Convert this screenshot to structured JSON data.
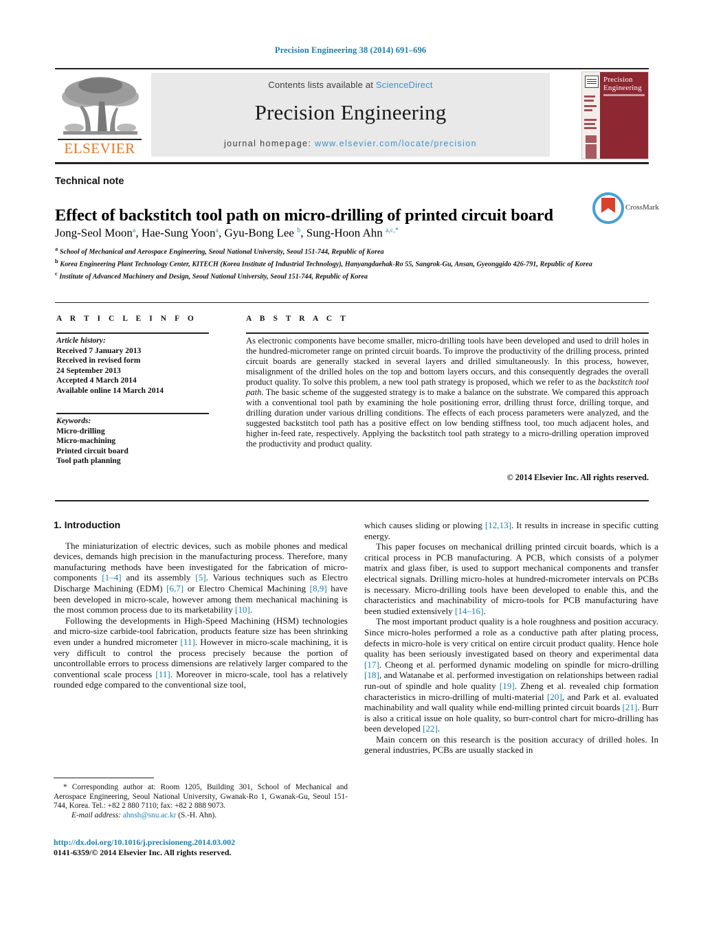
{
  "running_head": "Precision Engineering 38 (2014) 691–696",
  "masthead": {
    "publisher_name": "ELSEVIER",
    "contents_prefix": "Contents lists available at ",
    "contents_link": "ScienceDirect",
    "journal_title": "Precision Engineering",
    "homepage_prefix": "journal homepage: ",
    "homepage_url": "www.elsevier.com/locate/precision",
    "cover_title_line1": "Precision",
    "cover_title_line2": "Engineering"
  },
  "article": {
    "kind": "Technical note",
    "title": "Effect of backstitch tool path on micro-drilling of printed circuit board",
    "crossmark_label": "CrossMark",
    "authors_html": "Jong-Seol Moon<sup>a</sup>, Hae-Sung Yoon<sup>a</sup>, Gyu-Bong Lee <sup>b</sup>, Sung-Hoon Ahn <sup>a,c,<span class=\"star\">*</span></sup>",
    "affiliations": [
      "School of Mechanical and Aerospace Engineering, Seoul National University, Seoul 151-744, Republic of Korea",
      "Korea Engineering Plant Technology Center, KITECH (Korea Institute of Industrial Technology), Hanyangdaehak-Ro 55, Sangrok-Gu, Ansan, Gyeonggido 426-791, Republic of Korea",
      "Institute of Advanced Machinery and Design, Seoul National University, Seoul 151-744, Republic of Korea"
    ]
  },
  "article_info": {
    "heading": "A R T I C L E   I N F O",
    "history_label": "Article history:",
    "history": [
      "Received 7 January 2013",
      "Received in revised form",
      "24 September 2013",
      "Accepted 4 March 2014",
      "Available online 14 March 2014"
    ],
    "keywords_label": "Keywords:",
    "keywords": [
      "Micro-drilling",
      "Micro-machining",
      "Printed circuit board",
      "Tool path planning"
    ]
  },
  "abstract": {
    "heading": "A B S T R A C T",
    "text_html": "As electronic components have become smaller, micro-drilling tools have been developed and used to drill holes in the hundred-micrometer range on printed circuit boards. To improve the productivity of the drilling process, printed circuit boards are generally stacked in several layers and drilled simultaneously. In this process, however, misalignment of the drilled holes on the top and bottom layers occurs, and this consequently degrades the overall product quality. To solve this problem, a new tool path strategy is proposed, which we refer to as the <i>backstitch tool path</i>. The basic scheme of the suggested strategy is to make a balance on the substrate. We compared this approach with a conventional tool path by examining the hole positioning error, drilling thrust force, drilling torque, and drilling duration under various drilling conditions. The effects of each process parameters were analyzed, and the suggested backstitch tool path has a positive effect on low bending stiffness tool, too much adjacent holes, and higher in-feed rate, respectively. Applying the backstitch tool path strategy to a micro-drilling operation improved the productivity and product quality.",
    "copyright": "© 2014 Elsevier Inc. All rights reserved."
  },
  "body": {
    "section_heading": "1. Introduction",
    "left_paragraphs_html": [
      "The miniaturization of electric devices, such as mobile phones and medical devices, demands high precision in the manufacturing process. Therefore, many manufacturing methods have been investigated for the fabrication of micro-components <span class=\"ref\">[1–4]</span> and its assembly <span class=\"ref\">[5]</span>. Various techniques such as Electro Discharge Machining (EDM) <span class=\"ref\">[6,7]</span> or Electro Chemical Machining <span class=\"ref\">[8,9]</span> have been developed in micro-scale, however among them mechanical machining is the most common process due to its marketability <span class=\"ref\">[10]</span>.",
      "Following the developments in High-Speed Machining (HSM) technologies and micro-size carbide-tool fabrication, products feature size has been shrinking even under a hundred micrometer <span class=\"ref\">[11]</span>. However in micro-scale machining, it is very difficult to control the process precisely because the portion of uncontrollable errors to process dimensions are relatively larger compared to the conventional scale process <span class=\"ref\">[11]</span>. Moreover in micro-scale, tool has a relatively rounded edge compared to the conventional size tool,"
    ],
    "right_paragraphs_html": [
      "which causes sliding or plowing <span class=\"ref\">[12,13]</span>. It results in increase in specific cutting energy.",
      "This paper focuses on mechanical drilling printed circuit boards, which is a critical process in PCB manufacturing. A PCB, which consists of a polymer matrix and glass fiber, is used to support mechanical components and transfer electrical signals. Drilling micro-holes at hundred-micrometer intervals on PCBs is necessary. Micro-drilling tools have been developed to enable this, and the characteristics and machinability of micro-tools for PCB manufacturing have been studied extensively <span class=\"ref\">[14–16]</span>.",
      "The most important product quality is a hole roughness and position accuracy. Since micro-holes performed a role as a conductive path after plating process, defects in micro-hole is very critical on entire circuit product quality. Hence hole quality has been seriously investigated based on theory and experimental data <span class=\"ref\">[17]</span>. Cheong et al. performed dynamic modeling on spindle for micro-drilling <span class=\"ref\">[18]</span>, and Watanabe et al. performed investigation on relationships between radial run-out of spindle and hole quality <span class=\"ref\">[19]</span>. Zheng et al. revealed chip formation characteristics in micro-drilling of multi-material <span class=\"ref\">[20]</span>, and Park et al. evaluated machinability and wall quality while end-milling printed circuit boards <span class=\"ref\">[21]</span>. Burr is also a critical issue on hole quality, so burr-control chart for micro-drilling has been developed <span class=\"ref\">[22]</span>.",
      "Main concern on this research is the position accuracy of drilled holes. In general industries, PCBs are usually stacked in"
    ]
  },
  "footer": {
    "corresponding_html": "<span>*</span> Corresponding author at: Room 1205, Building 301, School of Mechanical and Aerospace Engineering, Seoul National University, Gwanak-Ro 1, Gwanak-Gu, Seoul 151-744, Korea. Tel.: +82 2 880 7110; fax: +82 2 888 9073.",
    "email_label": "E-mail address:",
    "email": "ahnsh@snu.ac.kr",
    "email_suffix": " (S.-H. Ahn).",
    "doi": "http://dx.doi.org/10.1016/j.precisioneng.2014.03.002",
    "issn_line": "0141-6359/© 2014 Elsevier Inc. All rights reserved."
  },
  "colors": {
    "link": "#1a7fad",
    "science_direct": "#3a93c6",
    "elsevier_orange": "#E87722",
    "cover_maroon": "#8d2832",
    "band_gray": "#e9e9e9"
  }
}
